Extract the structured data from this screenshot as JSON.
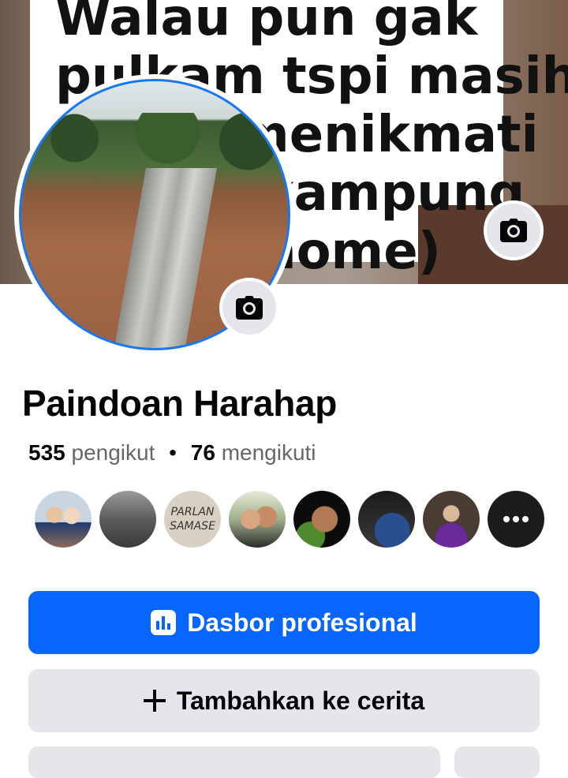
{
  "cover": {
    "lines": [
      "Walau pun gak",
      "pulkam tspi masih",
      "menikmati",
      "kampung",
      "home)"
    ]
  },
  "profile": {
    "name": "Paindoan Harahap",
    "followers_count": "535",
    "followers_label": "pengikut",
    "separator": "•",
    "following_count": "76",
    "following_label": "mengikuti"
  },
  "followers_avatars": [
    {
      "name": "follower-1",
      "text": ""
    },
    {
      "name": "follower-2",
      "text": ""
    },
    {
      "name": "follower-3",
      "text": "PARLAN\nSAMASE"
    },
    {
      "name": "follower-4",
      "text": ""
    },
    {
      "name": "follower-5",
      "text": ""
    },
    {
      "name": "follower-6",
      "text": ""
    },
    {
      "name": "follower-7",
      "text": ""
    },
    {
      "name": "more",
      "text": ""
    }
  ],
  "actions": {
    "primary_label": "Dasbor profesional",
    "secondary_label": "Tambahkan ke cerita"
  },
  "colors": {
    "primary": "#0866ff",
    "secondary_bg": "#e4e6eb",
    "muted_text": "#65676b"
  },
  "icons": {
    "cover_camera": "camera-icon",
    "avatar_camera": "camera-icon",
    "dashboard": "dashboard-icon",
    "add": "plus-icon",
    "more": "more-dots-icon"
  }
}
